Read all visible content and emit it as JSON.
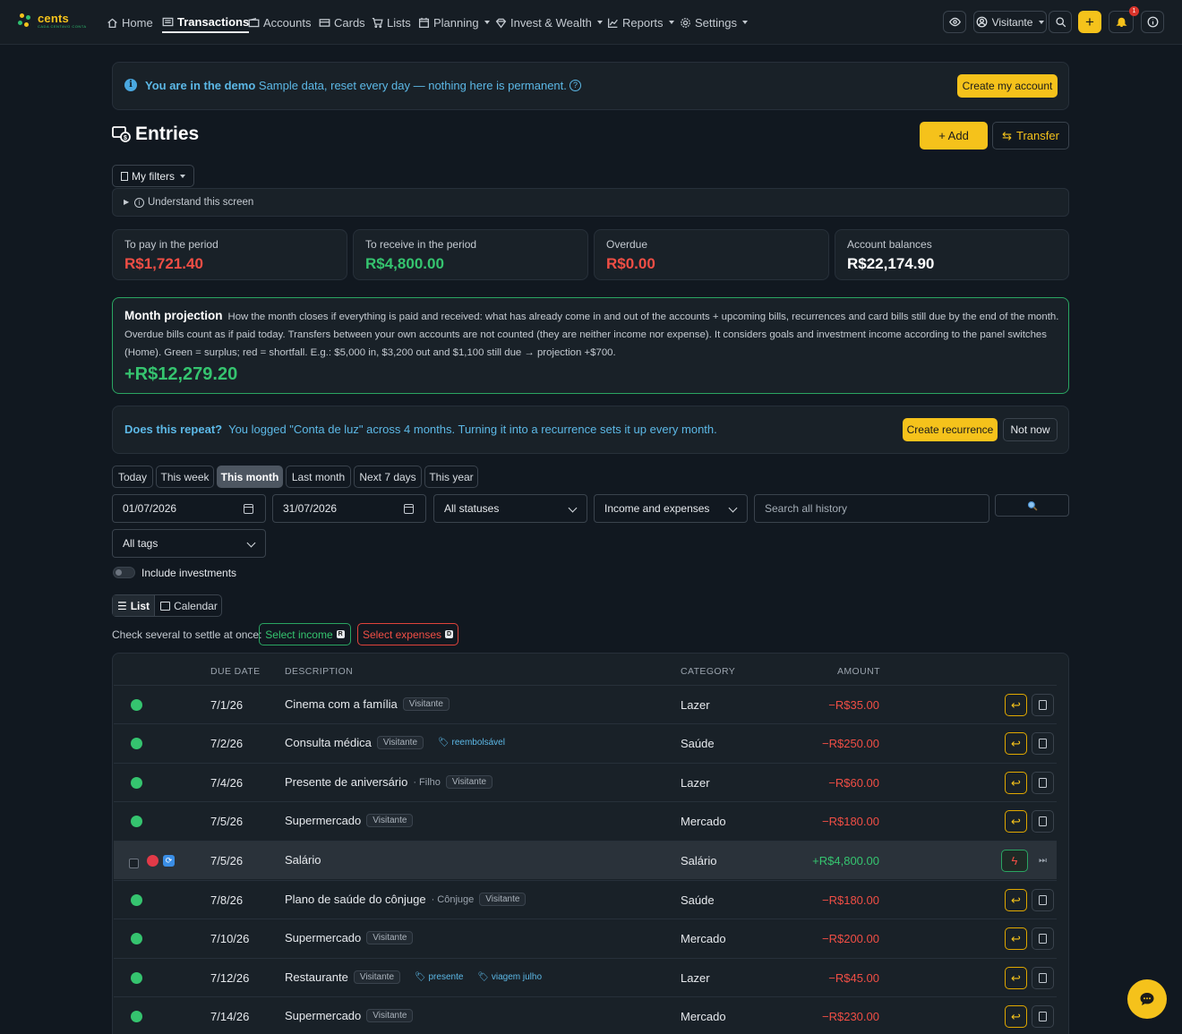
{
  "brand": {
    "name": "cents",
    "tagline": "CADA CENTAVO CONTA"
  },
  "nav": {
    "home": "Home",
    "transactions": "Transactions",
    "accounts": "Accounts",
    "cards": "Cards",
    "lists": "Lists",
    "planning": "Planning",
    "invest": "Invest & Wealth",
    "reports": "Reports",
    "settings": "Settings",
    "user": "Visitante",
    "plus": "+",
    "notif_count": "1"
  },
  "demo": {
    "bold": "You are in the demo",
    "text": "Sample data, reset every day — nothing here is permanent.",
    "help": "?",
    "cta": "Create my account"
  },
  "page": {
    "title": "Entries",
    "add": "+ Add",
    "transfer": "Transfer",
    "my_filters": "My filters",
    "understand": "Understand this screen"
  },
  "stats": [
    {
      "label": "To pay in the period",
      "value": "R$1,721.40"
    },
    {
      "label": "To receive in the period",
      "value": "R$4,800.00"
    },
    {
      "label": "Overdue",
      "value": "R$0.00"
    },
    {
      "label": "Account balances",
      "value": "R$22,174.90"
    }
  ],
  "projection": {
    "title": "Month projection",
    "text": "How the month closes if everything is paid and received: what has already come in and out of the accounts + upcoming bills, recurrences and card bills still due by the end of the month. Overdue bills count as if paid today. Transfers between your own accounts are not counted (they are neither income nor expense). It considers goals and investment income according to the panel switches (Home). Green = surplus; red = shortfall. E.g.: $5,000 in, $3,200 out and $1,100 still due → projection +$700.",
    "value": "+R$12,279.20"
  },
  "repeat": {
    "bold": "Does this repeat?",
    "text": "You logged \"Conta de luz\" across 4 months. Turning it into a recurrence sets it up every month.",
    "create": "Create recurrence",
    "dismiss": "Not now"
  },
  "periods": [
    "Today",
    "This week",
    "This month",
    "Last month",
    "Next 7 days",
    "This year"
  ],
  "active_period": "This month",
  "filters": {
    "date_from": "01/07/2026",
    "date_to": "31/07/2026",
    "status": "All statuses",
    "type": "Income and expenses",
    "search_placeholder": "Search all history",
    "tags": "All tags",
    "include_investments": "Include investments"
  },
  "views": {
    "list": "List",
    "calendar": "Calendar"
  },
  "bulk": {
    "label": "Check several to settle at once:",
    "income": "Select income",
    "income_key": "R",
    "expenses": "Select expenses",
    "expenses_key": "D"
  },
  "table": {
    "headers": {
      "due": "DUE DATE",
      "desc": "DESCRIPTION",
      "cat": "CATEGORY",
      "amount": "AMOUNT"
    },
    "rows": [
      {
        "date": "7/1/26",
        "desc": "Cinema com a família",
        "sub": "",
        "pill": "Visitante",
        "tags": [],
        "cat": "Lazer",
        "amount": "−R$35.00"
      },
      {
        "date": "7/2/26",
        "desc": "Consulta médica",
        "sub": "",
        "pill": "Visitante",
        "tags": [
          "🏷 reembolsável"
        ],
        "cat": "Saúde",
        "amount": "−R$250.00"
      },
      {
        "date": "7/4/26",
        "desc": "Presente de aniversário",
        "sub": "· Filho",
        "pill": "Visitante",
        "tags": [],
        "cat": "Lazer",
        "amount": "−R$60.00"
      },
      {
        "date": "7/5/26",
        "desc": "Supermercado",
        "sub": "",
        "pill": "Visitante",
        "tags": [],
        "cat": "Mercado",
        "amount": "−R$180.00"
      },
      {
        "date": "7/5/26",
        "desc": "Salário",
        "sub": "",
        "pill": "",
        "tags": [],
        "cat": "Salário",
        "amount": "+R$4,800.00"
      },
      {
        "date": "7/8/26",
        "desc": "Plano de saúde do cônjuge",
        "sub": "· Cônjuge",
        "pill": "Visitante",
        "tags": [],
        "cat": "Saúde",
        "amount": "−R$180.00"
      },
      {
        "date": "7/10/26",
        "desc": "Supermercado",
        "sub": "",
        "pill": "Visitante",
        "tags": [],
        "cat": "Mercado",
        "amount": "−R$200.00"
      },
      {
        "date": "7/12/26",
        "desc": "Restaurante",
        "sub": "",
        "pill": "Visitante",
        "tags": [
          "🏷 presente",
          "🏷 viagem julho"
        ],
        "cat": "Lazer",
        "amount": "−R$45.00"
      },
      {
        "date": "7/14/26",
        "desc": "Supermercado",
        "sub": "",
        "pill": "Visitante",
        "tags": [],
        "cat": "Mercado",
        "amount": "−R$230.00"
      }
    ]
  },
  "colors": {
    "accent": "#f5c21b",
    "income": "#35c46f",
    "expense": "#f04e45",
    "info": "#5cb8e6"
  }
}
